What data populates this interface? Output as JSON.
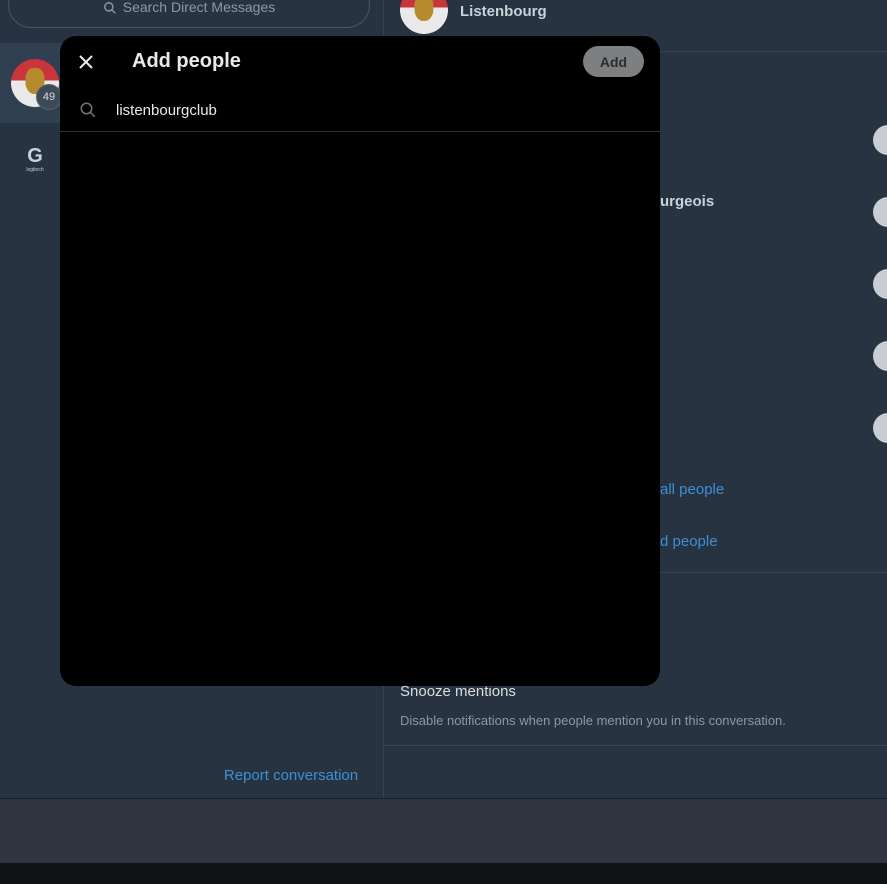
{
  "left_panel": {
    "search_placeholder": "Search Direct Messages",
    "selected_conversation": {
      "unread_badge": "49"
    },
    "logitech_text": "logitech"
  },
  "right_panel": {
    "header_title": "Listenbourg",
    "partial_member_name": "urgeois",
    "link_all_people": "all people",
    "link_add_people": "d people",
    "snooze_title": "Snooze mentions",
    "snooze_description": "Disable notifications when people mention you in this conversation.",
    "report_label": "Report conversation"
  },
  "modal": {
    "title": "Add people",
    "add_button": "Add",
    "search_value": "listenbourgclub"
  },
  "icons": [
    "search-icon",
    "close-icon"
  ],
  "colors": {
    "accent_link": "#3a8fd6",
    "modal_bg": "#000000",
    "add_button_disabled": "#7d7f80"
  }
}
